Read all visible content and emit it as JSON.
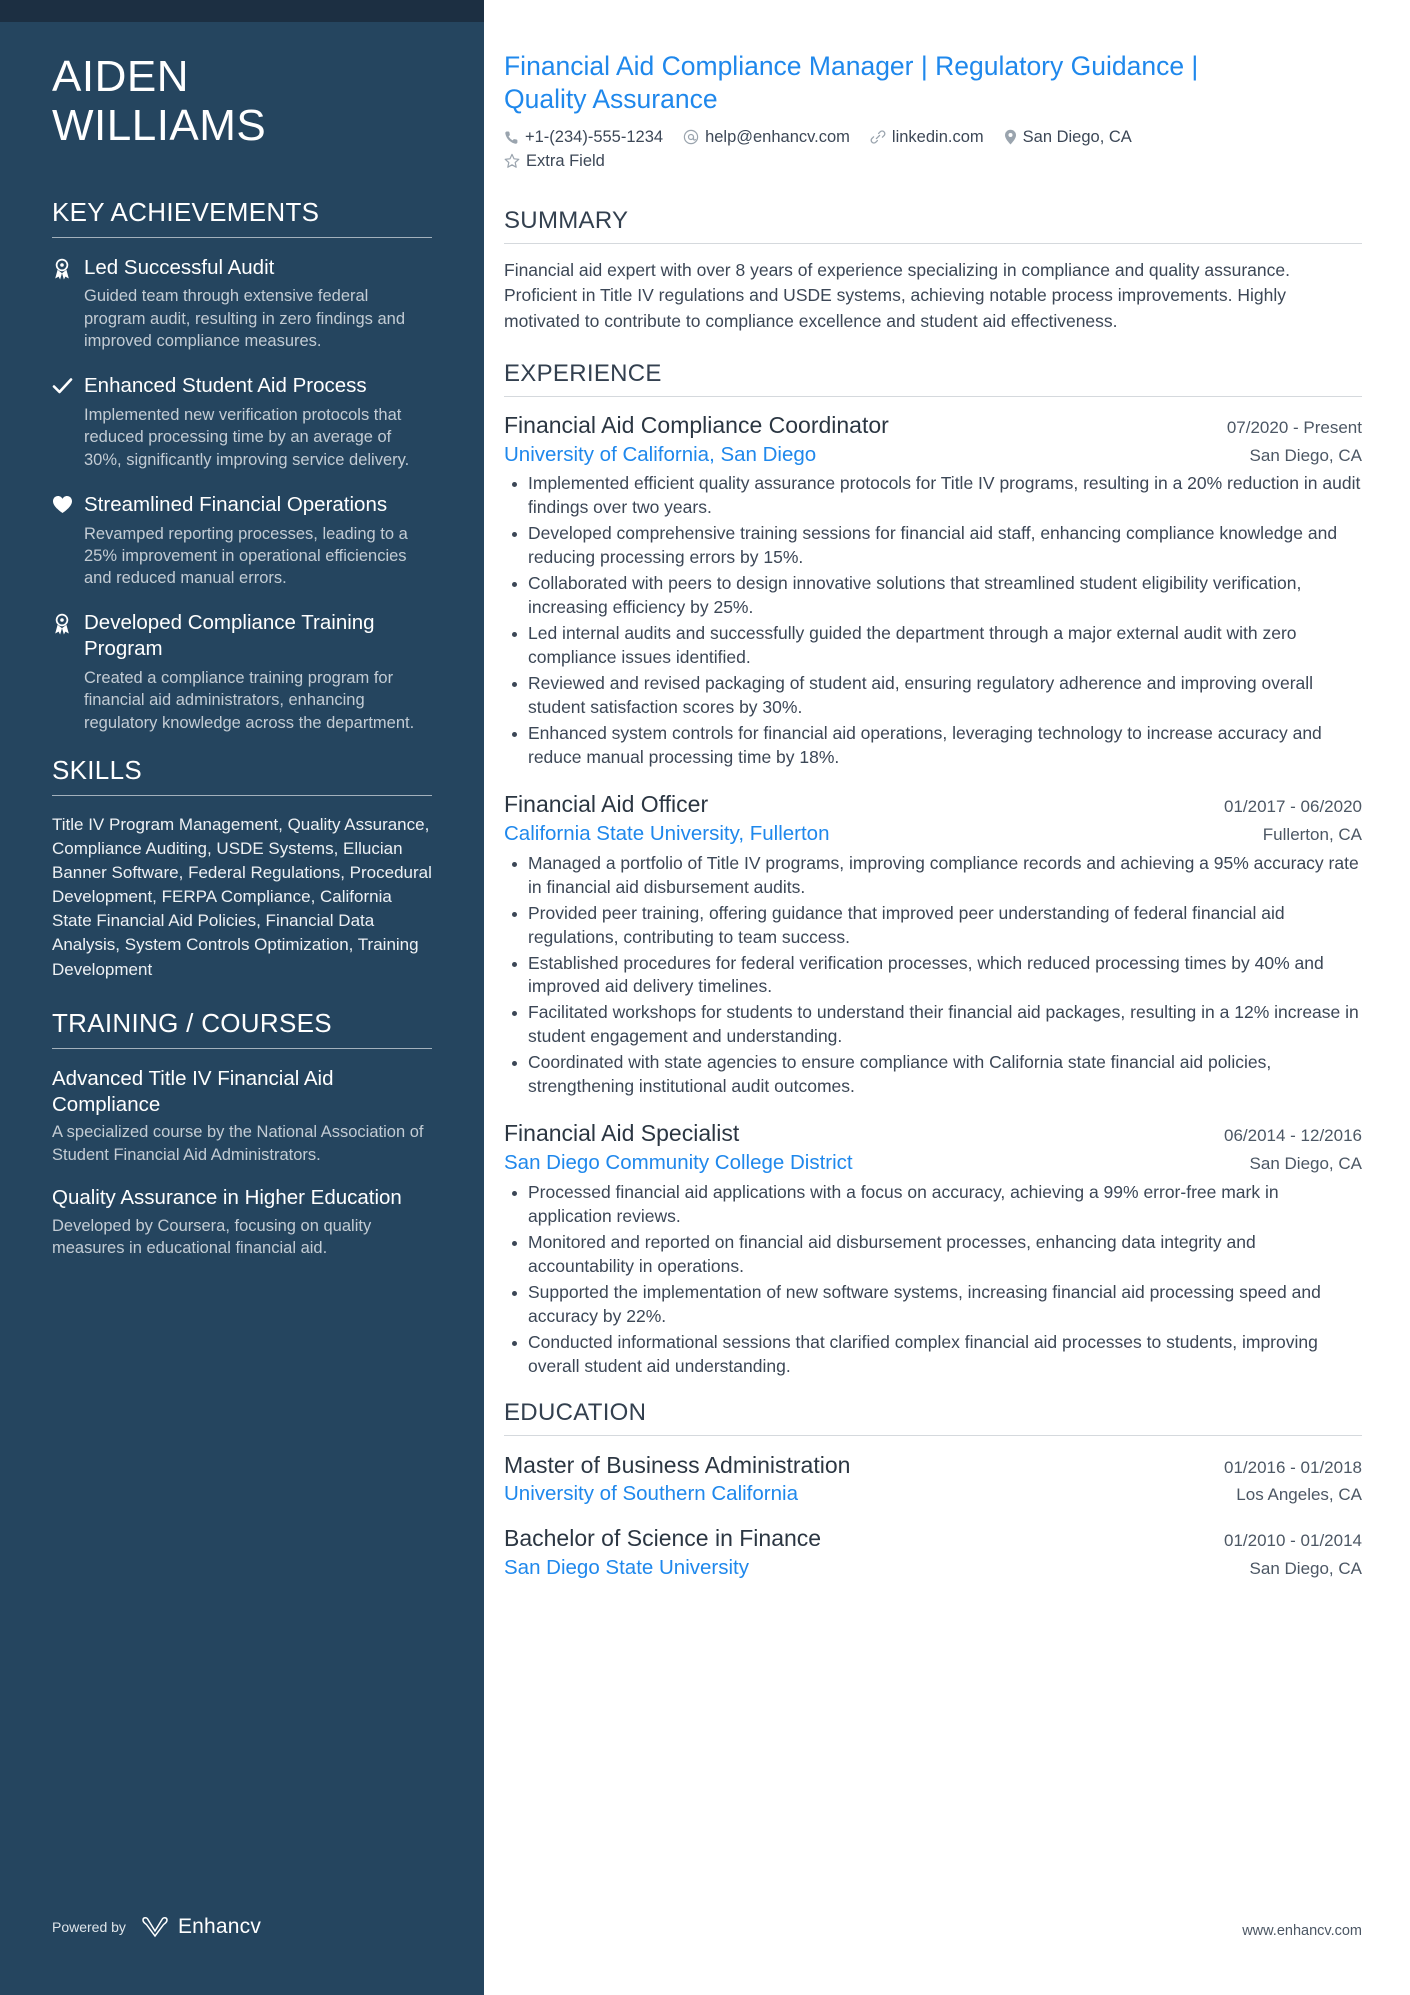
{
  "sidebar": {
    "name": {
      "first": "AIDEN",
      "last": "WILLIAMS"
    },
    "achievements_heading": "KEY ACHIEVEMENTS",
    "achievements": [
      {
        "icon": "award-ribbon-icon",
        "title": "Led Successful Audit",
        "desc": "Guided team through extensive federal program audit, resulting in zero findings and improved compliance measures."
      },
      {
        "icon": "check-icon",
        "title": "Enhanced Student Aid Process",
        "desc": "Implemented new verification protocols that reduced processing time by an average of 30%, significantly improving service delivery."
      },
      {
        "icon": "heart-icon",
        "title": "Streamlined Financial Operations",
        "desc": "Revamped reporting processes, leading to a 25% improvement in operational efficiencies and reduced manual errors."
      },
      {
        "icon": "award-ribbon-icon",
        "title": "Developed Compliance Training Program",
        "desc": "Created a compliance training program for financial aid administrators, enhancing regulatory knowledge across the department."
      }
    ],
    "skills_heading": "SKILLS",
    "skills_text": "Title IV Program Management, Quality Assurance, Compliance Auditing, USDE Systems, Ellucian Banner Software, Federal Regulations, Procedural Development, FERPA Compliance, California State Financial Aid Policies, Financial Data Analysis, System Controls Optimization, Training Development",
    "training_heading": "TRAINING / COURSES",
    "courses": [
      {
        "title": "Advanced Title IV Financial Aid Compliance",
        "desc": "A specialized course by the National Association of Student Financial Aid Administrators."
      },
      {
        "title": "Quality Assurance in Higher Education",
        "desc": "Developed by Coursera, focusing on quality measures in educational financial aid."
      }
    ],
    "footer": {
      "powered_by": "Powered by",
      "brand": "Enhancv"
    }
  },
  "main": {
    "headline": "Financial Aid Compliance Manager | Regulatory Guidance | Quality Assurance",
    "contacts": [
      {
        "icon": "phone-icon",
        "text": "+1-(234)-555-1234"
      },
      {
        "icon": "at-email-icon",
        "text": "help@enhancv.com"
      },
      {
        "icon": "link-icon",
        "text": "linkedin.com"
      },
      {
        "icon": "location-pin-icon",
        "text": "San Diego, CA"
      },
      {
        "icon": "star-icon",
        "text": "Extra Field"
      }
    ],
    "summary_heading": "SUMMARY",
    "summary_text": "Financial aid expert with over 8 years of experience specializing in compliance and quality assurance. Proficient in Title IV regulations and USDE systems, achieving notable process improvements. Highly motivated to contribute to compliance excellence and student aid effectiveness.",
    "experience_heading": "EXPERIENCE",
    "experience": [
      {
        "title": "Financial Aid Compliance Coordinator",
        "date": "07/2020 - Present",
        "company": "University of California, San Diego",
        "location": "San Diego, CA",
        "bullets": [
          "Implemented efficient quality assurance protocols for Title IV programs, resulting in a 20% reduction in audit findings over two years.",
          "Developed comprehensive training sessions for financial aid staff, enhancing compliance knowledge and reducing processing errors by 15%.",
          "Collaborated with peers to design innovative solutions that streamlined student eligibility verification, increasing efficiency by 25%.",
          "Led internal audits and successfully guided the department through a major external audit with zero compliance issues identified.",
          "Reviewed and revised packaging of student aid, ensuring regulatory adherence and improving overall student satisfaction scores by 30%.",
          "Enhanced system controls for financial aid operations, leveraging technology to increase accuracy and reduce manual processing time by 18%."
        ]
      },
      {
        "title": "Financial Aid Officer",
        "date": "01/2017 - 06/2020",
        "company": "California State University, Fullerton",
        "location": "Fullerton, CA",
        "bullets": [
          "Managed a portfolio of Title IV programs, improving compliance records and achieving a 95% accuracy rate in financial aid disbursement audits.",
          "Provided peer training, offering guidance that improved peer understanding of federal financial aid regulations, contributing to team success.",
          "Established procedures for federal verification processes, which reduced processing times by 40% and improved aid delivery timelines.",
          "Facilitated workshops for students to understand their financial aid packages, resulting in a 12% increase in student engagement and understanding.",
          "Coordinated with state agencies to ensure compliance with California state financial aid policies, strengthening institutional audit outcomes."
        ]
      },
      {
        "title": "Financial Aid Specialist",
        "date": "06/2014 - 12/2016",
        "company": "San Diego Community College District",
        "location": "San Diego, CA",
        "bullets": [
          "Processed financial aid applications with a focus on accuracy, achieving a 99% error-free mark in application reviews.",
          "Monitored and reported on financial aid disbursement processes, enhancing data integrity and accountability in operations.",
          "Supported the implementation of new software systems, increasing financial aid processing speed and accuracy by 22%.",
          "Conducted informational sessions that clarified complex financial aid processes to students, improving overall student aid understanding."
        ]
      }
    ],
    "education_heading": "EDUCATION",
    "education": [
      {
        "degree": "Master of Business Administration",
        "date": "01/2016 - 01/2018",
        "school": "University of Southern California",
        "location": "Los Angeles, CA"
      },
      {
        "degree": "Bachelor of Science in Finance",
        "date": "01/2010 - 01/2014",
        "school": "San Diego State University",
        "location": "San Diego, CA"
      }
    ],
    "footer_url": "www.enhancv.com"
  },
  "colors": {
    "sidebar_bg": "#25455f",
    "sidebar_topbar": "#1c2f42",
    "accent_blue": "#1f88ec",
    "body_text": "#3c4756"
  }
}
